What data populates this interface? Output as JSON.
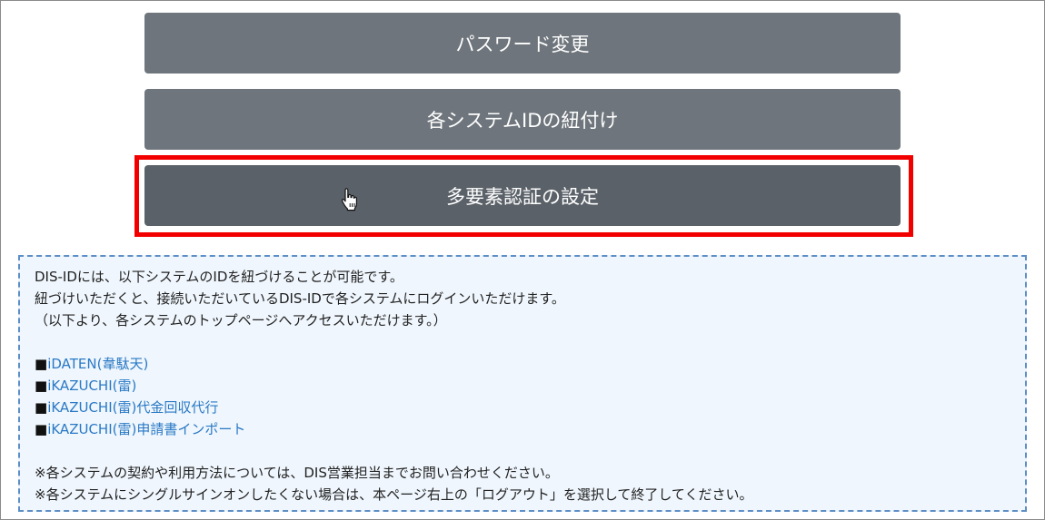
{
  "menu": {
    "password_change_label": "パスワード変更",
    "system_id_link_label": "各システムIDの紐付け",
    "mfa_settings_label": "多要素認証の設定"
  },
  "info": {
    "lines": [
      "DIS-IDには、以下システムのIDを紐づけることが可能です。",
      "紐づけいただくと、接続いただいているDIS-IDで各システムにログインいただけます。",
      "（以下より、各システムのトップページへアクセスいただけます。）"
    ],
    "bullet": "■",
    "systems": [
      "iDATEN(韋駄天)",
      "iKAZUCHI(雷)",
      "iKAZUCHI(雷)代金回収代行",
      "iKAZUCHI(雷)申請書インポート"
    ],
    "notes": [
      "※各システムの契約や利用方法については、DIS営業担当までお問い合わせください。",
      "※各システムにシングルサインオンしたくない場合は、本ページ右上の「ログアウト」を選択して終了してください。"
    ]
  },
  "colors": {
    "button": "#6e757c",
    "button_hover": "#5a6168",
    "highlight": "#f20000",
    "info_border": "#5d8ec5",
    "info_bg": "#eff6fd",
    "link": "#2a79c5"
  },
  "icons": {
    "cursor": "hand-pointer-icon"
  }
}
